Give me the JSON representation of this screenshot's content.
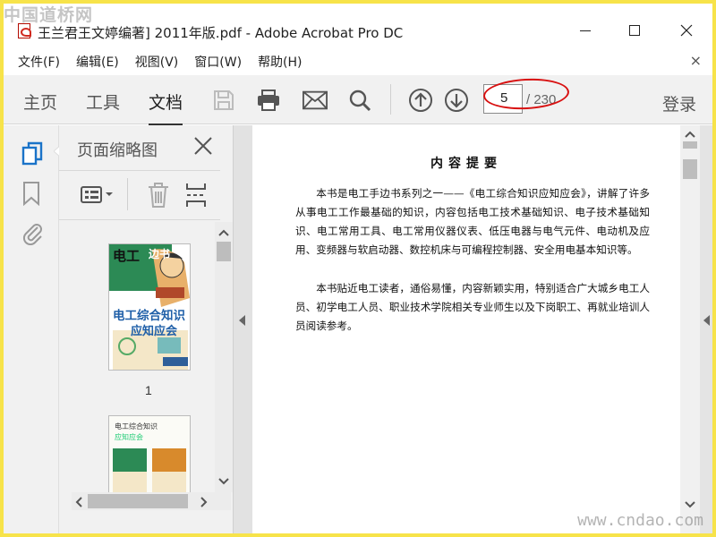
{
  "watermark": {
    "top_left": "中国道桥网",
    "bottom_right": "www.cndao.com"
  },
  "window": {
    "title": "王兰君王文婷编著] 2011年版.pdf - Adobe Acrobat Pro DC",
    "minimize_glyph": "—",
    "maximize_glyph": "☐",
    "close_glyph": "✕"
  },
  "menu": {
    "items": [
      "文件(F)",
      "编辑(E)",
      "视图(V)",
      "窗口(W)",
      "帮助(H)"
    ],
    "close_glyph": "×"
  },
  "toolbar": {
    "tabs": [
      "主页",
      "工具",
      "文档"
    ],
    "active_tab": "文档",
    "icons": [
      "save-icon",
      "print-icon",
      "email-icon",
      "search-icon",
      "page-up-icon",
      "page-down-icon"
    ],
    "current_page": "5",
    "total_pages": "/ 230",
    "login": "登录",
    "highlight_color": "#d81010"
  },
  "sidebar": {
    "rail_icons": [
      "page-thumbnails-icon",
      "bookmark-icon",
      "attachment-icon"
    ],
    "panel_title": "页面缩略图",
    "thumbnails": [
      {
        "label": "1",
        "cover_lines": [
          "电工",
          "边书",
          "电工综合知识",
          "应知应会"
        ]
      },
      {
        "label": "",
        "cover_lines": [
          "电工综合知识",
          "应知应会"
        ]
      }
    ]
  },
  "document": {
    "heading": "内容提要",
    "paragraphs": [
      "本书是电工手边书系列之一——《电工综合知识应知应会》，讲解了许多从事电工工作最基础的知识，内容包括电工技术基础知识、电子技术基础知识、电工常用工具、电工常用仪器仪表、低压电器与电气元件、电动机及应用、变频器与软启动器、数控机床与可编程控制器、安全用电基本知识等。",
      "本书贴近电工读者，通俗易懂，内容新颖实用，特别适合广大城乡电工人员、初学电工人员、职业技术学院相关专业师生以及下岗职工、再就业培训人员阅读参考。"
    ]
  }
}
